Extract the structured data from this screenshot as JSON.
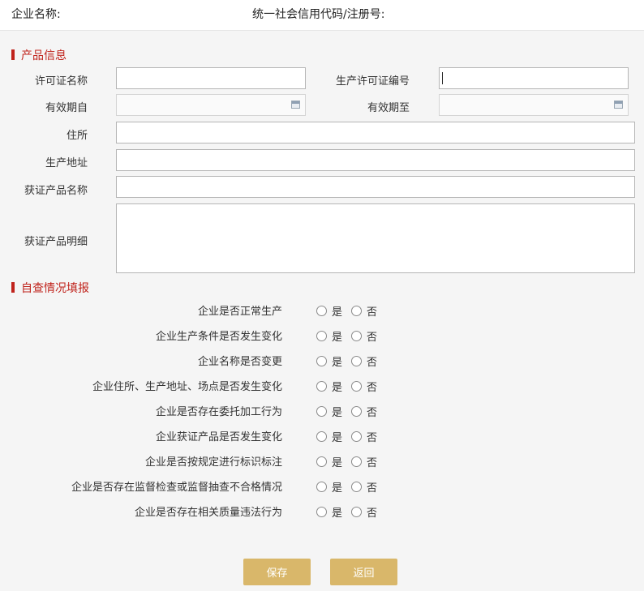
{
  "header": {
    "company_name_label": "企业名称:",
    "credit_code_label": "统一社会信用代码/注册号:"
  },
  "product_info": {
    "title": "产品信息",
    "license_name_label": "许可证名称",
    "license_no_label": "生产许可证编号",
    "valid_from_label": "有效期自",
    "valid_to_label": "有效期至",
    "address_label": "住所",
    "production_address_label": "生产地址",
    "product_name_label": "获证产品名称",
    "product_detail_label": "获证产品明细"
  },
  "self_check": {
    "title": "自查情况填报",
    "yes_label": "是",
    "no_label": "否",
    "questions": [
      "企业是否正常生产",
      "企业生产条件是否发生变化",
      "企业名称是否变更",
      "企业住所、生产地址、场点是否发生变化",
      "企业是否存在委托加工行为",
      "企业获证产品是否发生变化",
      "企业是否按规定进行标识标注",
      "企业是否存在监督检查或监督抽查不合格情况",
      "企业是否存在相关质量违法行为"
    ]
  },
  "actions": {
    "save_label": "保存",
    "back_label": "返回"
  },
  "colors": {
    "accent_red": "#c0231c",
    "button_gold": "#d9b76a"
  },
  "icons": {
    "date_picker": "calendar-icon",
    "option": "radio-icon"
  }
}
